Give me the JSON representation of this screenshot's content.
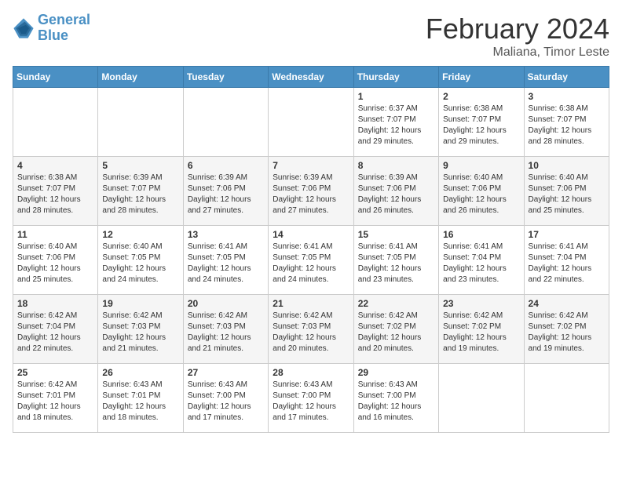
{
  "header": {
    "logo_line1": "General",
    "logo_line2": "Blue",
    "month_title": "February 2024",
    "location": "Maliana, Timor Leste"
  },
  "days_of_week": [
    "Sunday",
    "Monday",
    "Tuesday",
    "Wednesday",
    "Thursday",
    "Friday",
    "Saturday"
  ],
  "weeks": [
    [
      {
        "day": "",
        "info": ""
      },
      {
        "day": "",
        "info": ""
      },
      {
        "day": "",
        "info": ""
      },
      {
        "day": "",
        "info": ""
      },
      {
        "day": "1",
        "info": "Sunrise: 6:37 AM\nSunset: 7:07 PM\nDaylight: 12 hours and 29 minutes."
      },
      {
        "day": "2",
        "info": "Sunrise: 6:38 AM\nSunset: 7:07 PM\nDaylight: 12 hours and 29 minutes."
      },
      {
        "day": "3",
        "info": "Sunrise: 6:38 AM\nSunset: 7:07 PM\nDaylight: 12 hours and 28 minutes."
      }
    ],
    [
      {
        "day": "4",
        "info": "Sunrise: 6:38 AM\nSunset: 7:07 PM\nDaylight: 12 hours and 28 minutes."
      },
      {
        "day": "5",
        "info": "Sunrise: 6:39 AM\nSunset: 7:07 PM\nDaylight: 12 hours and 28 minutes."
      },
      {
        "day": "6",
        "info": "Sunrise: 6:39 AM\nSunset: 7:06 PM\nDaylight: 12 hours and 27 minutes."
      },
      {
        "day": "7",
        "info": "Sunrise: 6:39 AM\nSunset: 7:06 PM\nDaylight: 12 hours and 27 minutes."
      },
      {
        "day": "8",
        "info": "Sunrise: 6:39 AM\nSunset: 7:06 PM\nDaylight: 12 hours and 26 minutes."
      },
      {
        "day": "9",
        "info": "Sunrise: 6:40 AM\nSunset: 7:06 PM\nDaylight: 12 hours and 26 minutes."
      },
      {
        "day": "10",
        "info": "Sunrise: 6:40 AM\nSunset: 7:06 PM\nDaylight: 12 hours and 25 minutes."
      }
    ],
    [
      {
        "day": "11",
        "info": "Sunrise: 6:40 AM\nSunset: 7:06 PM\nDaylight: 12 hours and 25 minutes."
      },
      {
        "day": "12",
        "info": "Sunrise: 6:40 AM\nSunset: 7:05 PM\nDaylight: 12 hours and 24 minutes."
      },
      {
        "day": "13",
        "info": "Sunrise: 6:41 AM\nSunset: 7:05 PM\nDaylight: 12 hours and 24 minutes."
      },
      {
        "day": "14",
        "info": "Sunrise: 6:41 AM\nSunset: 7:05 PM\nDaylight: 12 hours and 24 minutes."
      },
      {
        "day": "15",
        "info": "Sunrise: 6:41 AM\nSunset: 7:05 PM\nDaylight: 12 hours and 23 minutes."
      },
      {
        "day": "16",
        "info": "Sunrise: 6:41 AM\nSunset: 7:04 PM\nDaylight: 12 hours and 23 minutes."
      },
      {
        "day": "17",
        "info": "Sunrise: 6:41 AM\nSunset: 7:04 PM\nDaylight: 12 hours and 22 minutes."
      }
    ],
    [
      {
        "day": "18",
        "info": "Sunrise: 6:42 AM\nSunset: 7:04 PM\nDaylight: 12 hours and 22 minutes."
      },
      {
        "day": "19",
        "info": "Sunrise: 6:42 AM\nSunset: 7:03 PM\nDaylight: 12 hours and 21 minutes."
      },
      {
        "day": "20",
        "info": "Sunrise: 6:42 AM\nSunset: 7:03 PM\nDaylight: 12 hours and 21 minutes."
      },
      {
        "day": "21",
        "info": "Sunrise: 6:42 AM\nSunset: 7:03 PM\nDaylight: 12 hours and 20 minutes."
      },
      {
        "day": "22",
        "info": "Sunrise: 6:42 AM\nSunset: 7:02 PM\nDaylight: 12 hours and 20 minutes."
      },
      {
        "day": "23",
        "info": "Sunrise: 6:42 AM\nSunset: 7:02 PM\nDaylight: 12 hours and 19 minutes."
      },
      {
        "day": "24",
        "info": "Sunrise: 6:42 AM\nSunset: 7:02 PM\nDaylight: 12 hours and 19 minutes."
      }
    ],
    [
      {
        "day": "25",
        "info": "Sunrise: 6:42 AM\nSunset: 7:01 PM\nDaylight: 12 hours and 18 minutes."
      },
      {
        "day": "26",
        "info": "Sunrise: 6:43 AM\nSunset: 7:01 PM\nDaylight: 12 hours and 18 minutes."
      },
      {
        "day": "27",
        "info": "Sunrise: 6:43 AM\nSunset: 7:00 PM\nDaylight: 12 hours and 17 minutes."
      },
      {
        "day": "28",
        "info": "Sunrise: 6:43 AM\nSunset: 7:00 PM\nDaylight: 12 hours and 17 minutes."
      },
      {
        "day": "29",
        "info": "Sunrise: 6:43 AM\nSunset: 7:00 PM\nDaylight: 12 hours and 16 minutes."
      },
      {
        "day": "",
        "info": ""
      },
      {
        "day": "",
        "info": ""
      }
    ]
  ]
}
